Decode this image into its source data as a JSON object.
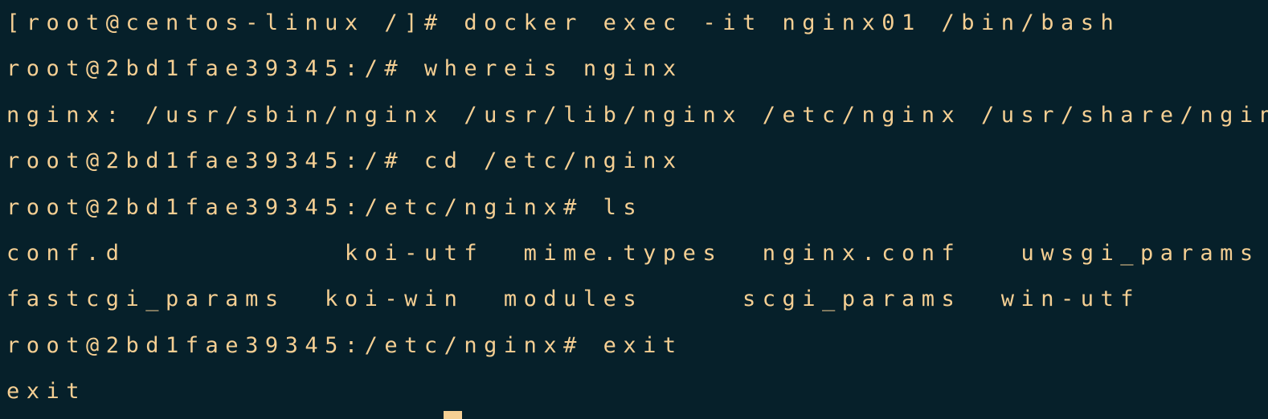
{
  "terminal": {
    "lines": [
      "[root@centos-linux /]# docker exec -it nginx01 /bin/bash",
      "root@2bd1fae39345:/# whereis nginx",
      "nginx: /usr/sbin/nginx /usr/lib/nginx /etc/nginx /usr/share/nginx",
      "root@2bd1fae39345:/# cd /etc/nginx",
      "root@2bd1fae39345:/etc/nginx# ls",
      "conf.d           koi-utf  mime.types  nginx.conf   uwsgi_params",
      "fastcgi_params  koi-win  modules     scgi_params  win-utf",
      "root@2bd1fae39345:/etc/nginx# exit",
      "exit"
    ]
  },
  "colors": {
    "background": "#06202a",
    "text": "#f5cf93"
  }
}
